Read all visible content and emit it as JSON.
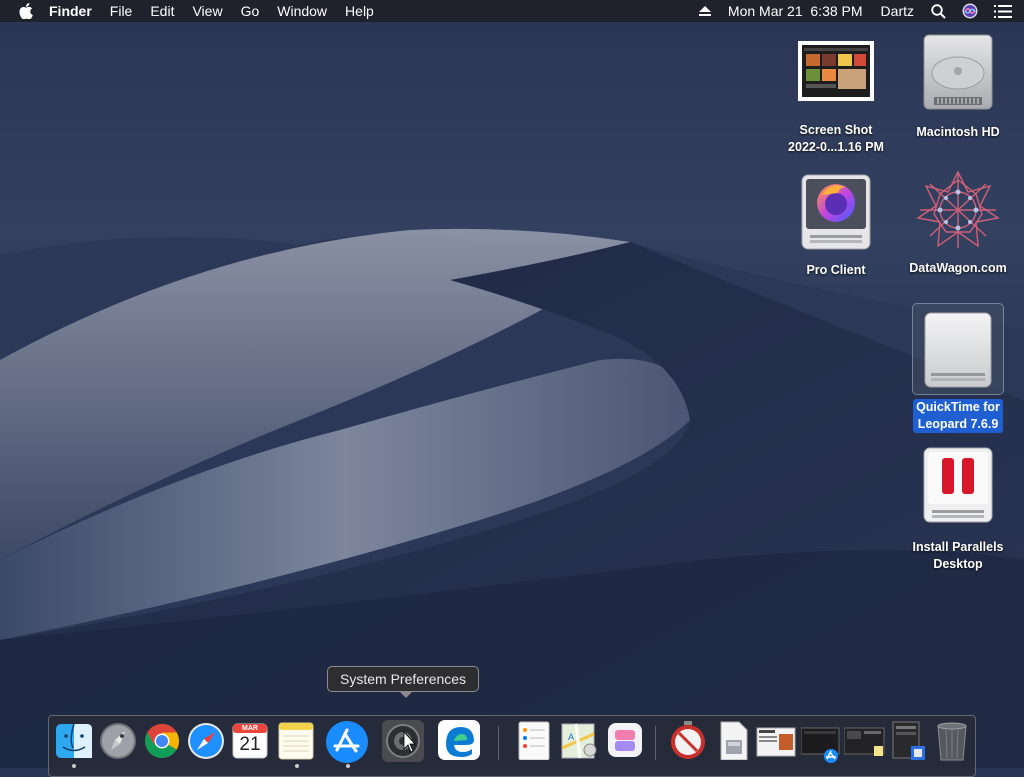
{
  "menubar": {
    "app_name": "Finder",
    "menus": [
      "File",
      "Edit",
      "View",
      "Go",
      "Window",
      "Help"
    ],
    "clock": "Mon Mar 21  6:38 PM",
    "user": "Dartz",
    "icons": [
      "apple-icon",
      "eject-icon",
      "spotlight-search-icon",
      "siri-icon",
      "control-strip-icon"
    ]
  },
  "desktop": {
    "icons": [
      {
        "label_lines": [
          "Screen Shot",
          "2022-0...1.16 PM"
        ],
        "icon": "screenshot-thumbnail-icon"
      },
      {
        "label_lines": [
          "Macintosh HD"
        ],
        "icon": "hard-drive-icon"
      },
      {
        "label_lines": [
          "Pro Client"
        ],
        "icon": "firefox-disk-image-icon"
      },
      {
        "label_lines": [
          "DataWagon.com"
        ],
        "icon": "datawagon-icon"
      },
      {
        "label_lines": [
          "QuickTime for",
          "Leopard 7.6.9"
        ],
        "icon": "disk-image-icon",
        "selected": true
      },
      {
        "label_lines": [
          "Install Parallels",
          "Desktop"
        ],
        "icon": "parallels-installer-icon"
      }
    ]
  },
  "tooltip": {
    "text": "System Preferences"
  },
  "dock": {
    "apps": [
      {
        "name": "Finder",
        "icon": "finder-icon",
        "running": true
      },
      {
        "name": "Launchpad",
        "icon": "launchpad-icon",
        "running": false
      },
      {
        "name": "Google Chrome",
        "icon": "chrome-icon",
        "running": false
      },
      {
        "name": "Safari",
        "icon": "safari-icon",
        "running": false
      },
      {
        "name": "Calendar",
        "icon": "calendar-icon",
        "running": false,
        "month": "MAR",
        "day": "21"
      },
      {
        "name": "Notes",
        "icon": "notes-icon",
        "running": true
      },
      {
        "name": "App Store",
        "icon": "app-store-icon",
        "running": true
      },
      {
        "name": "System Preferences",
        "icon": "system-preferences-icon",
        "running": false
      },
      {
        "name": "Microsoft Edge",
        "icon": "edge-icon",
        "running": false
      }
    ],
    "documents": [
      {
        "icon": "reminders-icon"
      },
      {
        "icon": "maps-icon"
      },
      {
        "icon": "shortcuts-icon"
      },
      {
        "icon": "time-machine-icon"
      },
      {
        "icon": "archive-file-icon"
      },
      {
        "icon": "screenshot-stack-icon"
      },
      {
        "icon": "app-folder-stack-icon"
      },
      {
        "icon": "dark-screenshot-stack-icon"
      },
      {
        "icon": "document-stack-icon"
      },
      {
        "icon": "trash-icon"
      }
    ]
  }
}
